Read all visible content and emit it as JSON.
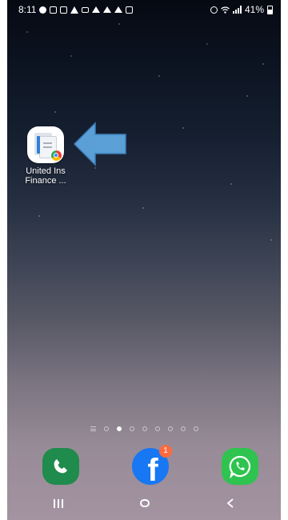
{
  "status_bar": {
    "time": "8:11",
    "battery": "41%",
    "left_icons": [
      "notification-icon",
      "notification-icon",
      "gallery-icon",
      "alert-icon",
      "mail-icon",
      "hiker-icon",
      "hiker-icon",
      "hiker-icon",
      "download-icon"
    ],
    "right_icons": [
      "alarm-icon",
      "wifi-icon",
      "signal-icon",
      "battery-icon"
    ]
  },
  "home_app": {
    "label_line1": "United Ins",
    "label_line2": "Finance ...",
    "icon": "document-icon",
    "badge_icon": "chrome-icon"
  },
  "annotation": {
    "icon": "arrow-left-icon",
    "color": "#5a9fd6"
  },
  "page_indicator": {
    "pages": 8,
    "active_index": 1
  },
  "dock": {
    "apps": [
      {
        "name": "Phone",
        "icon": "phone-icon",
        "color": "#1f8b4c"
      },
      {
        "name": "Facebook",
        "icon": "facebook-icon",
        "color": "#1877f2",
        "badge": "1"
      },
      {
        "name": "WhatsApp",
        "icon": "whatsapp-icon",
        "color": "#2fc34f"
      }
    ],
    "facebook_glyph": "f"
  },
  "navigation": {
    "buttons": [
      "recent-apps-icon",
      "home-icon",
      "back-icon"
    ]
  }
}
